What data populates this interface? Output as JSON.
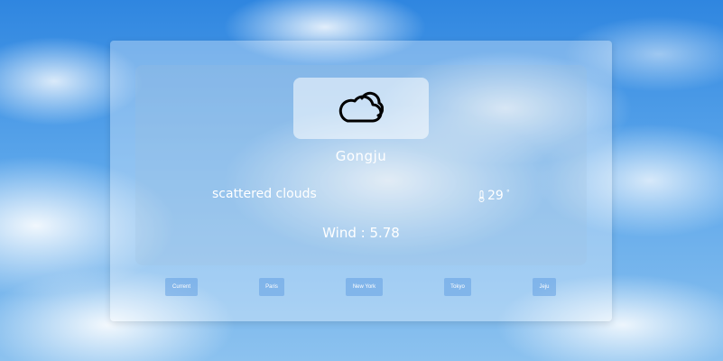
{
  "weather": {
    "city": "Gongju",
    "description": "scattered clouds",
    "temperature": "29",
    "temperature_unit": "°",
    "wind": "Wind : 5.78",
    "icon": "cloud-icon"
  },
  "cities": {
    "items": [
      {
        "label": "Current"
      },
      {
        "label": "Paris"
      },
      {
        "label": "New York"
      },
      {
        "label": "Tokyo"
      },
      {
        "label": "Jeju"
      }
    ]
  },
  "colors": {
    "text": "#ffffff",
    "button_bg": "#64a0e1"
  }
}
